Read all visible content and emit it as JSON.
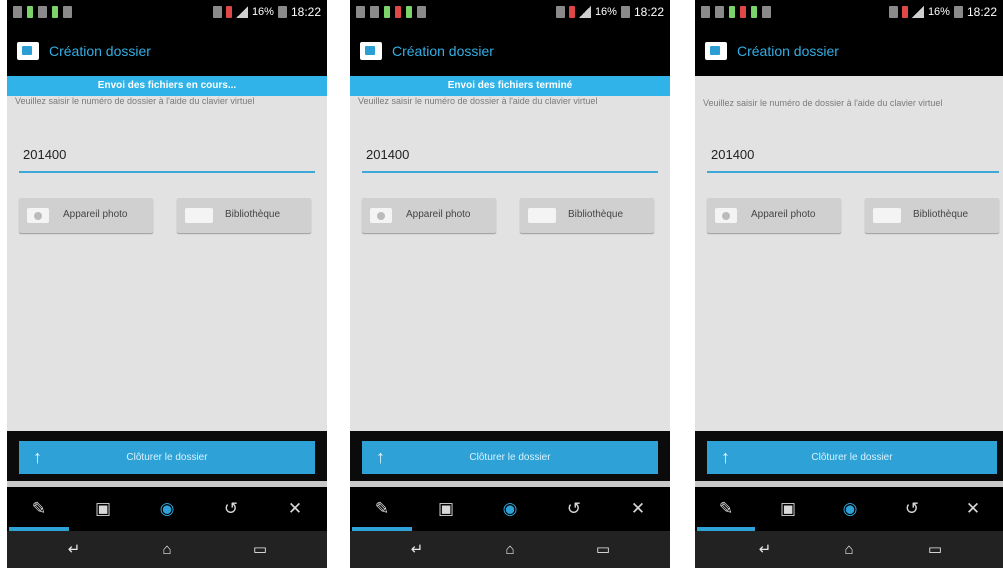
{
  "status_bar": {
    "battery_text": "16%",
    "time": "18:22"
  },
  "app_title": "Création dossier",
  "instruction": "Veuillez saisir le numéro de dossier à l'aide du clavier virtuel",
  "field_value": "201400",
  "photo_button": "Appareil photo",
  "library_button": "Bibliothèque",
  "close_button": "Clôturer le dossier",
  "close_arrow": "↑",
  "toast_progress": "Envoi des fichiers en cours...",
  "toast_done": "Envoi des fichiers terminé",
  "tab_icons": [
    "pencil-icon",
    "image-icon",
    "camera-icon",
    "history-icon",
    "tools-icon"
  ],
  "nav_icons": [
    "back-icon",
    "home-icon",
    "recent-apps-icon"
  ],
  "colors": {
    "accent": "#2fa3d8",
    "toast": "#2fb3e8",
    "background": "#e2e2e2"
  }
}
